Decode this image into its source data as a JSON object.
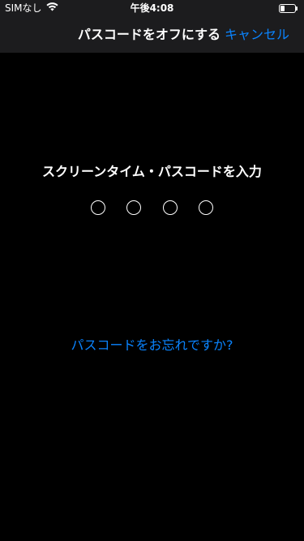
{
  "status_bar": {
    "carrier": "SIMなし",
    "time": "午後4:08",
    "wifi_icon": "wifi-icon",
    "battery_icon": "battery-icon",
    "battery_level": 0.3
  },
  "nav": {
    "title": "パスコードをオフにする",
    "cancel_label": "キャンセル",
    "accent_color": "#0a84ff"
  },
  "passcode": {
    "prompt": "スクリーンタイム・パスコードを入力",
    "digits": 4,
    "entered": 0,
    "forgot_label": "パスコードをお忘れですか?"
  }
}
